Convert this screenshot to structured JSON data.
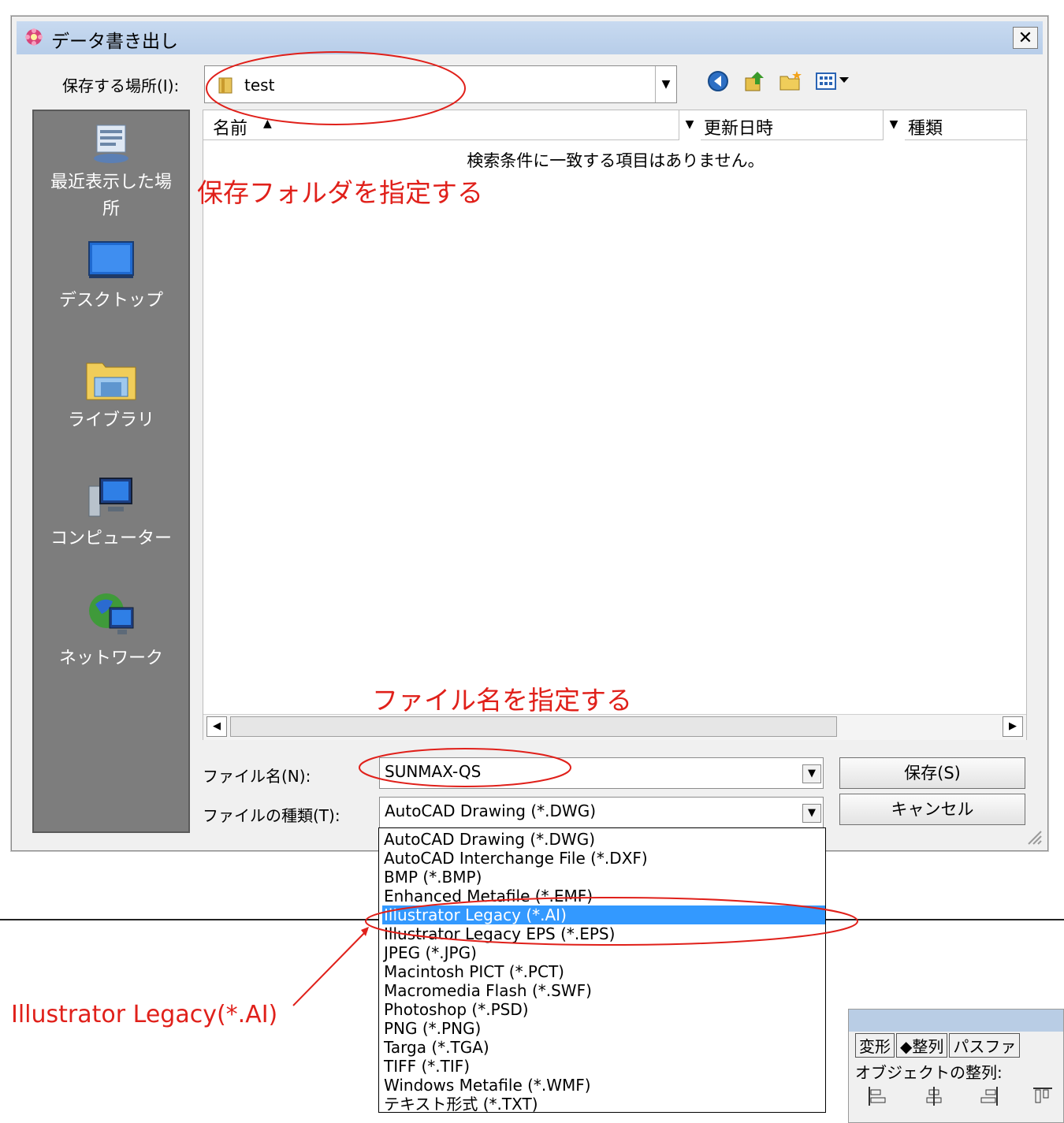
{
  "dialog": {
    "title": "データ書き出し",
    "close_label": "✕"
  },
  "location": {
    "label": "保存する場所(I):",
    "value": "test"
  },
  "toolbar_icons": [
    "back-icon",
    "up-folder-icon",
    "new-folder-icon",
    "view-menu-icon"
  ],
  "places": [
    {
      "label": "最近表示した場所",
      "icon": "recent-places-icon"
    },
    {
      "label": "デスクトップ",
      "icon": "desktop-icon"
    },
    {
      "label": "ライブラリ",
      "icon": "libraries-icon"
    },
    {
      "label": "コンピューター",
      "icon": "computer-icon"
    },
    {
      "label": "ネットワーク",
      "icon": "network-icon"
    }
  ],
  "columns": [
    "名前",
    "更新日時",
    "種類"
  ],
  "empty_message": "検索条件に一致する項目はありません。",
  "filename": {
    "label": "ファイル名(N):",
    "value": "SUNMAX-QS"
  },
  "filetype": {
    "label": "ファイルの種類(T):",
    "value": "AutoCAD Drawing (*.DWG)",
    "options": [
      "AutoCAD Drawing (*.DWG)",
      "AutoCAD Interchange File (*.DXF)",
      "BMP (*.BMP)",
      "Enhanced Metafile (*.EMF)",
      "Illustrator Legacy (*.AI)",
      "Illustrator Legacy EPS (*.EPS)",
      "JPEG (*.JPG)",
      "Macintosh PICT (*.PCT)",
      "Macromedia Flash (*.SWF)",
      "Photoshop (*.PSD)",
      "PNG (*.PNG)",
      "Targa (*.TGA)",
      "TIFF (*.TIF)",
      "Windows Metafile (*.WMF)",
      "テキスト形式 (*.TXT)"
    ],
    "selected_option": "Illustrator Legacy (*.AI)"
  },
  "buttons": {
    "save": "保存(S)",
    "cancel": "キャンセル"
  },
  "annotations": {
    "folder_note": "保存フォルダを指定する",
    "filename_note": "ファイル名を指定する",
    "format_note": "Illustrator Legacy(*.AI)",
    "color": "#e0201a"
  },
  "palette": {
    "tabs": [
      "変形",
      "整列",
      "パスファ"
    ],
    "section_label": "オブジェクトの整列:",
    "tool_icons": [
      "align-left-icon",
      "align-hcenter-icon",
      "align-right-icon",
      "align-top-icon"
    ]
  }
}
